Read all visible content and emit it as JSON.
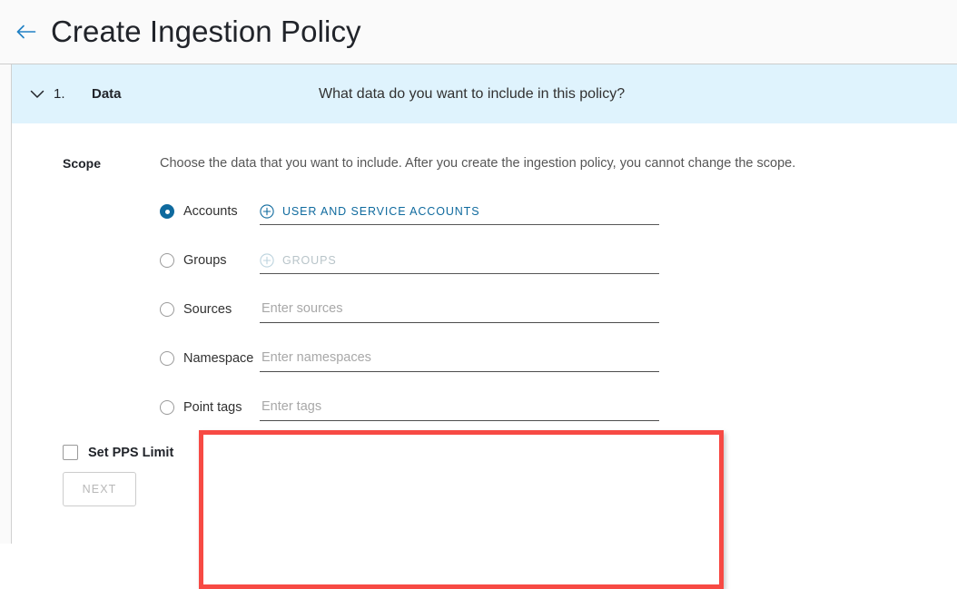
{
  "header": {
    "back_icon": "arrow-left-icon",
    "title": "Create Ingestion Policy",
    "accent_color": "#1f80c4"
  },
  "step": {
    "chevron_icon": "chevron-down-icon",
    "number": "1.",
    "name": "Data",
    "question": "What data do you want to include in this policy?",
    "banner_color": "#dff3fd",
    "expanded": true
  },
  "scope": {
    "label": "Scope",
    "description": "Choose the data that you want to include. After you create the ingestion policy, you cannot change the scope.",
    "options": [
      {
        "id": "accounts",
        "label": "Accounts",
        "selected": true,
        "control_type": "signpost",
        "link_label": "User and Service Accounts",
        "link_icon": "plus-circle-icon",
        "link_enabled": true
      },
      {
        "id": "groups",
        "label": "Groups",
        "selected": false,
        "control_type": "signpost",
        "link_label": "Groups",
        "link_icon": "plus-circle-icon",
        "link_enabled": false
      },
      {
        "id": "sources",
        "label": "Sources",
        "selected": false,
        "control_type": "input",
        "value": "",
        "placeholder": "Enter sources"
      },
      {
        "id": "namespace",
        "label": "Namespace",
        "selected": false,
        "control_type": "input",
        "value": "",
        "placeholder": "Enter namespaces"
      },
      {
        "id": "point-tags",
        "label": "Point tags",
        "selected": false,
        "control_type": "input",
        "value": "",
        "placeholder": "Enter tags"
      }
    ]
  },
  "highlight": {
    "color": "#f74a44",
    "covers": [
      "sources",
      "namespace",
      "point-tags"
    ]
  },
  "bottom": {
    "pps_checkbox_label": "Set PPS Limit",
    "pps_checked": false,
    "next_label": "Next",
    "next_enabled": false
  }
}
